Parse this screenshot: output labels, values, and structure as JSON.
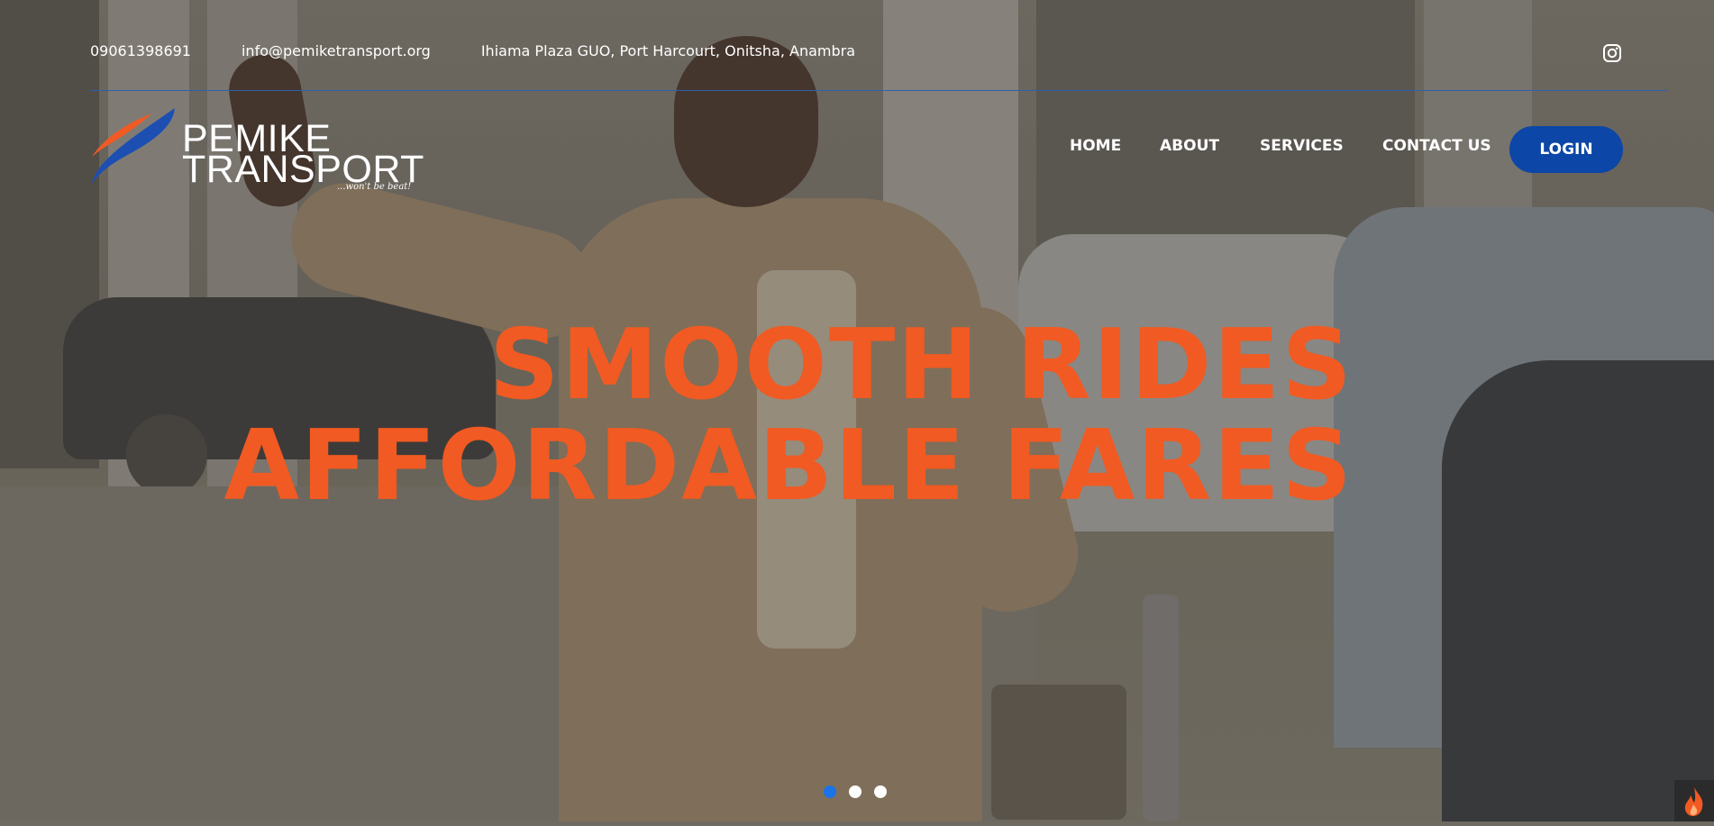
{
  "topbar": {
    "phone": "09061398691",
    "email": "info@pemiketransport.org",
    "address": "Ihiama Plaza GUO, Port Harcourt, Onitsha, Anambra",
    "social_icon": "instagram-icon"
  },
  "logo": {
    "line1": "PEMIKE",
    "line2": "TRANSPORT",
    "tagline": "...won't be beat!"
  },
  "nav": {
    "items": [
      {
        "label": "HOME"
      },
      {
        "label": "ABOUT"
      },
      {
        "label": "SERVICES"
      },
      {
        "label": "CONTACT US"
      }
    ],
    "login_label": "LOGIN"
  },
  "hero": {
    "line1": "SMOOTH RIDES",
    "line2": "AFFORDABLE FARES"
  },
  "carousel": {
    "slide_count": 3,
    "active_slide": 1
  },
  "colors": {
    "accent_orange": "#f15a22",
    "brand_blue": "#0c46a6",
    "divider_blue": "#2f5fae",
    "active_dot": "#1a73e8"
  },
  "corner_widget": {
    "icon": "flame-icon"
  }
}
